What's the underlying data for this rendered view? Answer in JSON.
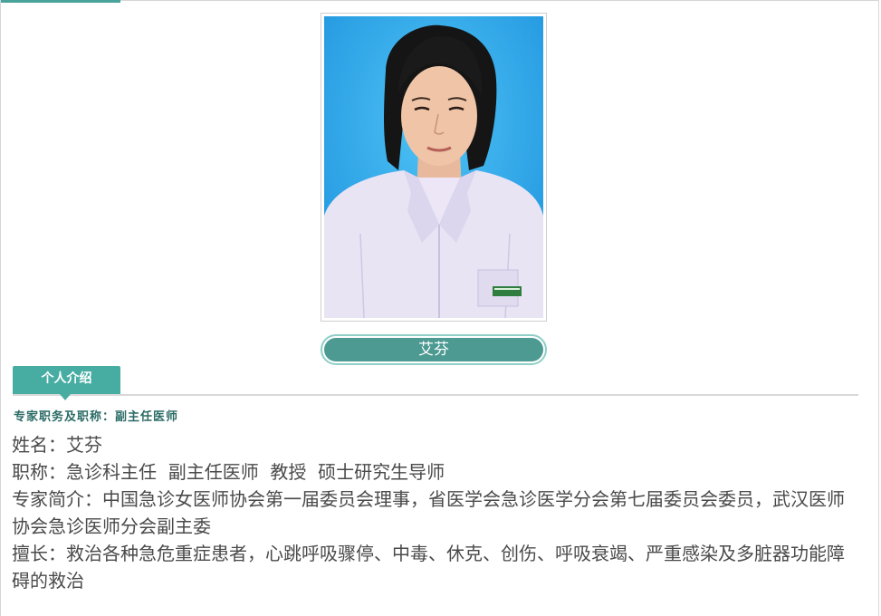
{
  "doctor": {
    "name": "艾芬",
    "photo_alt": "doctor-portrait"
  },
  "section_tab": {
    "label": "个人介绍"
  },
  "subhead": "专家职务及职称：副主任医师",
  "profile": {
    "name_line": "姓名：艾芬",
    "title_line": "职称：急诊科主任  副主任医师  教授  硕士研究生导师",
    "intro_line": "专家简介：中国急诊女医师协会第一届委员会理事，省医学会急诊医学分会第七届委员会委员，武汉医师协会急诊医师分会副主委",
    "specialty_line": "擅长：救治各种急危重症患者，心跳呼吸骤停、中毒、休克、创伤、呼吸衰竭、严重感染及多脏器功能障碍的救治"
  },
  "colors": {
    "accent": "#47ada3",
    "button_fill": "#4c9a91",
    "button_border": "#8fcfc6",
    "text": "#4a4a4a",
    "subhead": "#2b6b66",
    "photo_background": "#2aa6e8"
  }
}
